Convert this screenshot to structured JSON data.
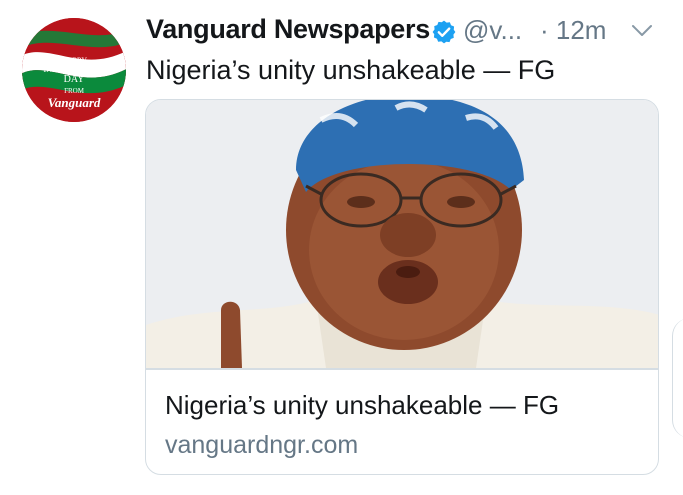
{
  "tweet": {
    "author_name": "Vanguard Newspapers",
    "handle": "@v...",
    "time": "· 12m",
    "text": "Nigeria’s unity unshakeable — FG"
  },
  "avatar": {
    "line1": "HAPPY",
    "line2": "INDEPENDENCE",
    "line3": "DAY",
    "line4": "FROM",
    "logo": "Vanguard"
  },
  "card": {
    "title": "Nigeria’s unity unshakeable — FG",
    "domain": "vanguardngr.com"
  },
  "colors": {
    "verified": "#1da1f2",
    "secondary_text": "#657786",
    "card_border": "#d5dde3",
    "avatar_red": "#b8141b",
    "nigeria_green": "#0b8a3c"
  },
  "icons": {
    "verified": "verified-badge-icon",
    "more": "chevron-down-icon"
  }
}
